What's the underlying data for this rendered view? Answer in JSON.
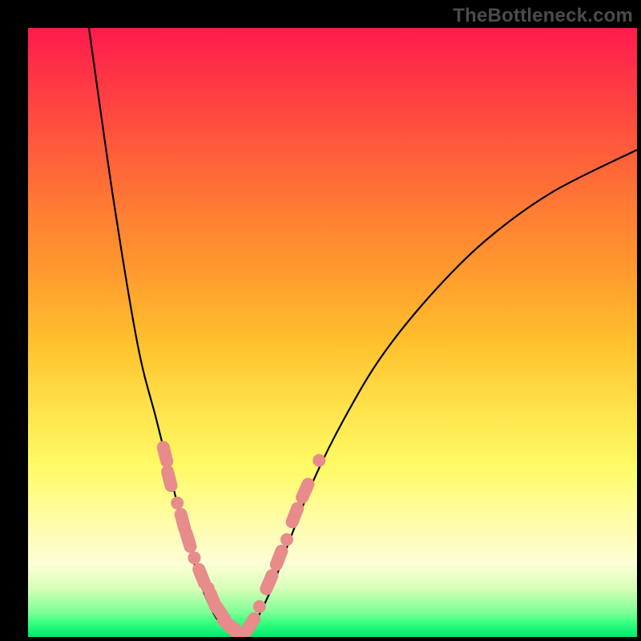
{
  "watermark": "TheBottleneck.com",
  "chart_data": {
    "type": "line",
    "title": "",
    "xlabel": "",
    "ylabel": "",
    "xlim": [
      0,
      100
    ],
    "ylim": [
      0,
      100
    ],
    "grid": false,
    "legend": false,
    "curve_left": [
      {
        "x": 10,
        "y": 100
      },
      {
        "x": 14,
        "y": 72
      },
      {
        "x": 18,
        "y": 48
      },
      {
        "x": 21,
        "y": 36
      },
      {
        "x": 23,
        "y": 28
      },
      {
        "x": 25,
        "y": 20
      },
      {
        "x": 27,
        "y": 13
      },
      {
        "x": 29,
        "y": 7
      },
      {
        "x": 31,
        "y": 3
      },
      {
        "x": 33,
        "y": 1
      },
      {
        "x": 35,
        "y": 0
      }
    ],
    "curve_right": [
      {
        "x": 35,
        "y": 0
      },
      {
        "x": 37,
        "y": 2
      },
      {
        "x": 40,
        "y": 8
      },
      {
        "x": 43,
        "y": 16
      },
      {
        "x": 47,
        "y": 26
      },
      {
        "x": 52,
        "y": 36
      },
      {
        "x": 58,
        "y": 46
      },
      {
        "x": 66,
        "y": 56
      },
      {
        "x": 75,
        "y": 65
      },
      {
        "x": 86,
        "y": 73
      },
      {
        "x": 100,
        "y": 80
      }
    ],
    "markers_left": [
      {
        "x": 22.5,
        "y": 30,
        "shape": "pill"
      },
      {
        "x": 23.2,
        "y": 26,
        "shape": "pill"
      },
      {
        "x": 24.5,
        "y": 22,
        "shape": "dot"
      },
      {
        "x": 25.4,
        "y": 19,
        "shape": "pill"
      },
      {
        "x": 26.3,
        "y": 16,
        "shape": "pill"
      },
      {
        "x": 27.3,
        "y": 13,
        "shape": "dot"
      },
      {
        "x": 28.5,
        "y": 10,
        "shape": "pill"
      },
      {
        "x": 29.6,
        "y": 8,
        "shape": "dot"
      },
      {
        "x": 30.4,
        "y": 6,
        "shape": "pill"
      },
      {
        "x": 31.6,
        "y": 4,
        "shape": "pill"
      },
      {
        "x": 33.0,
        "y": 2,
        "shape": "pill"
      },
      {
        "x": 34.0,
        "y": 1,
        "shape": "pill"
      }
    ],
    "markers_right": [
      {
        "x": 36.5,
        "y": 2,
        "shape": "pill"
      },
      {
        "x": 38.0,
        "y": 5,
        "shape": "dot"
      },
      {
        "x": 39.6,
        "y": 9,
        "shape": "pill"
      },
      {
        "x": 41.2,
        "y": 13,
        "shape": "pill"
      },
      {
        "x": 42.5,
        "y": 16,
        "shape": "dot"
      },
      {
        "x": 43.8,
        "y": 20,
        "shape": "pill"
      },
      {
        "x": 45.5,
        "y": 24,
        "shape": "pill"
      },
      {
        "x": 47.8,
        "y": 29,
        "shape": "dot"
      }
    ],
    "colors": {
      "curve": "#000000",
      "marker": "#e78b8b",
      "gradient_top": "#ff1a4d",
      "gradient_bottom": "#00e66e"
    }
  }
}
